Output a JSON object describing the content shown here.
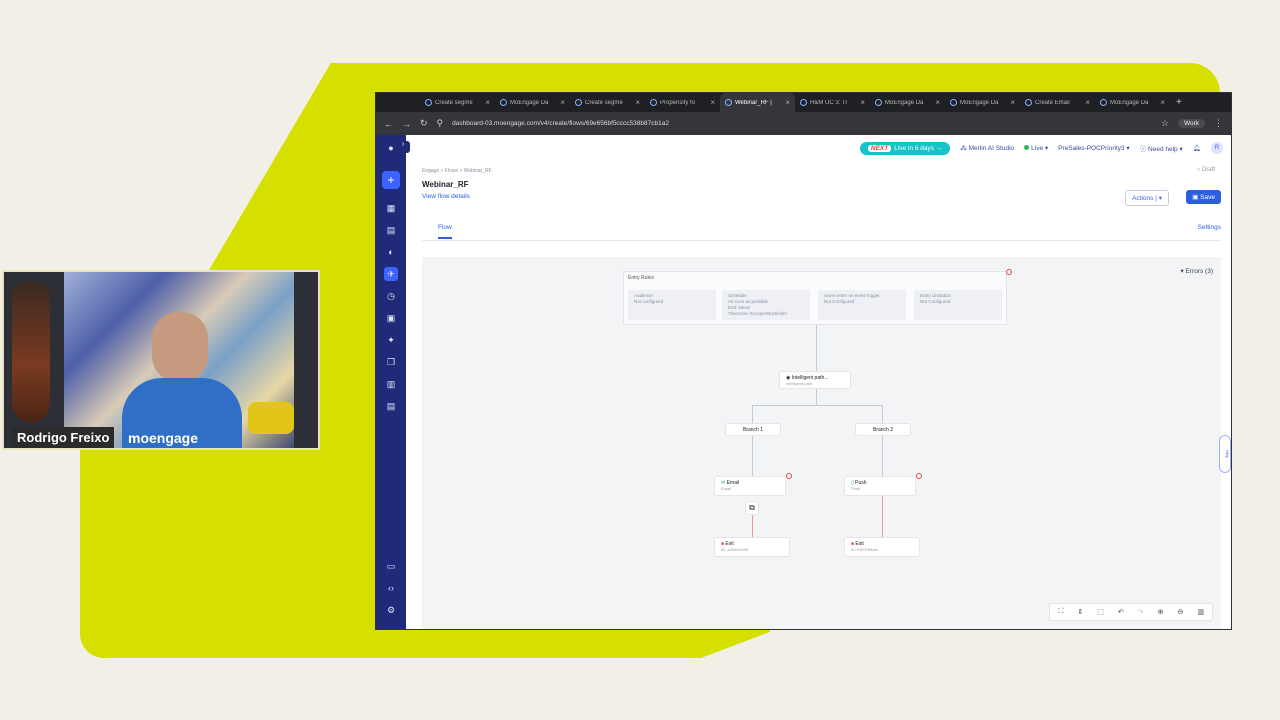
{
  "presenter": {
    "name": "Rodrigo Freixo",
    "brand": "moengage"
  },
  "browser": {
    "tabs": [
      {
        "label": "Create segme"
      },
      {
        "label": "MoEngage Da"
      },
      {
        "label": "Create segme"
      },
      {
        "label": "Propensity fo"
      },
      {
        "label": "Webinar_RF |",
        "active": true
      },
      {
        "label": "H&M UC 3: Tr"
      },
      {
        "label": "MoEngage Da"
      },
      {
        "label": "MoEngage Da"
      },
      {
        "label": "Create Email"
      },
      {
        "label": "MoEngage Da"
      }
    ],
    "url": "dashboard-03.moengage.com/v4/create/flows/69e656bf5cccc538b87cb1a2",
    "profile": "Work"
  },
  "app": {
    "next_badge": "NEXT",
    "next_text": "Live in 6 days →",
    "merlin": "Merlin AI Studio",
    "live": "Live",
    "workspace": "PreSales-POCPriority3",
    "need_help": "Need help",
    "avatar": "R",
    "breadcrumb": "Engage  >  Flows  >  Webinar_RF",
    "title": "Webinar_RF",
    "view_details": "View flow details",
    "draft": "Draft",
    "actions": "Actions",
    "save": "Save",
    "tab_flow": "Flow",
    "tab_settings": "Settings",
    "errors": "Errors (3)",
    "entry_rules": {
      "label": "Entry Rules",
      "cells": [
        {
          "title": "Audience",
          "value": "Not configured"
        },
        {
          "title": "Schedule",
          "value": "As soon as possible\nEnd: Never\nTimezone: Europe/Stockholm"
        },
        {
          "title": "Users enter on event trigger",
          "value": "Not Configured"
        },
        {
          "title": "Entry Limitation",
          "value": "Not Configured"
        }
      ]
    },
    "nodes": {
      "intelligent_path": {
        "label": "Intelligent path...",
        "sub": "Intelligent path"
      },
      "branch1": "Branch 1",
      "branch2": "Branch 2",
      "email": {
        "label": "Email",
        "sub": "Email"
      },
      "push": {
        "label": "Push",
        "sub": "Push"
      },
      "exit1": {
        "label": "Exit",
        "sub": "ID: a2b454Uf4t"
      },
      "exit2": {
        "label": "Exit",
        "sub": "ID: fUtPDfMuet"
      }
    },
    "help": "Help"
  }
}
